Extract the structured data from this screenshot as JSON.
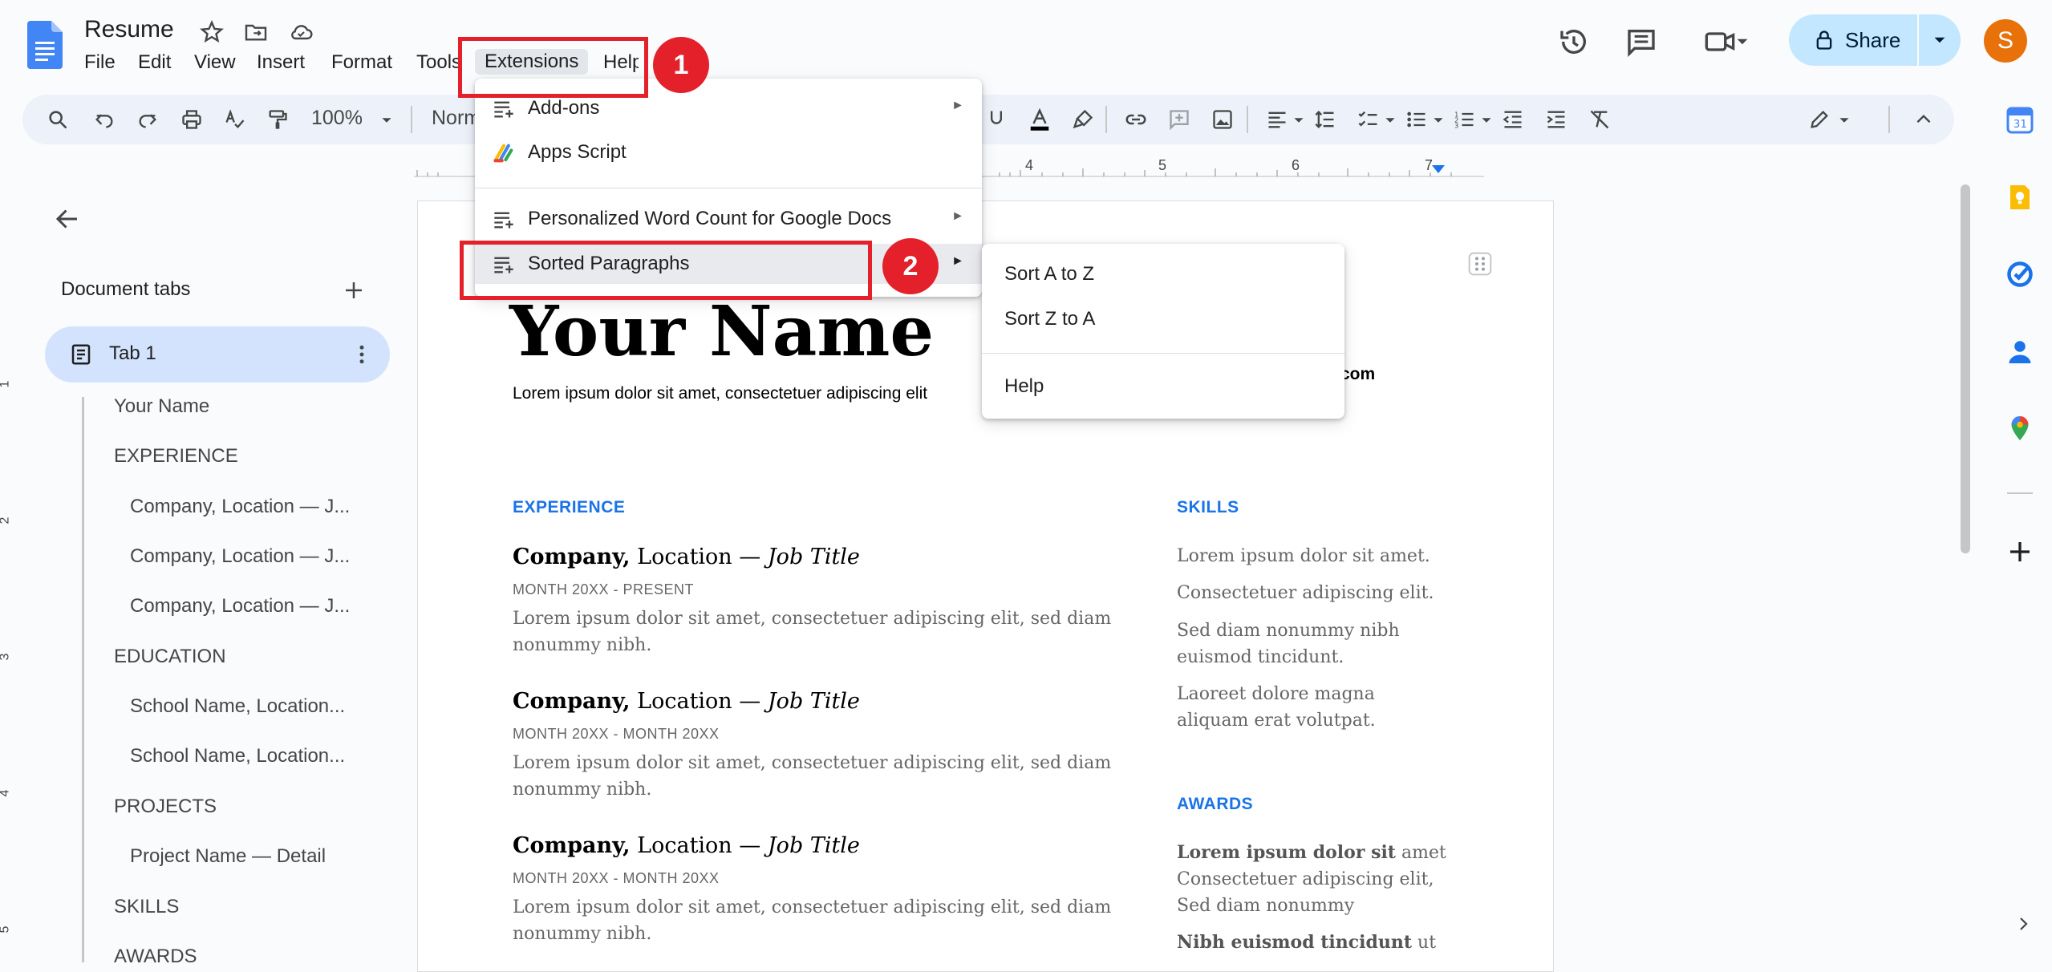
{
  "doc": {
    "title": "Resume"
  },
  "menubar": [
    "File",
    "Edit",
    "View",
    "Insert",
    "Format",
    "Tools",
    "Extensions",
    "Help"
  ],
  "toolbar": {
    "zoom": "100%",
    "style": "Norm"
  },
  "share": {
    "label": "Share"
  },
  "user": {
    "initial": "S"
  },
  "sidebar": {
    "heading": "Document tabs",
    "tab": "Tab 1",
    "outline": [
      "Your Name",
      "EXPERIENCE",
      "Company, Location — J...",
      "Company, Location — J...",
      "Company, Location — J...",
      "EDUCATION",
      "School Name, Location...",
      "School Name, Location...",
      "PROJECTS",
      "Project Name — Detail",
      "SKILLS",
      "AWARDS"
    ]
  },
  "ruler": {
    "numbers": [
      "4",
      "5",
      "6",
      "7"
    ],
    "vertical": [
      "1",
      "2",
      "3",
      "4",
      "5"
    ]
  },
  "extensions_menu": {
    "items": [
      "Add-ons",
      "Apps Script",
      "Personalized Word Count for Google Docs",
      "Sorted Paragraphs"
    ]
  },
  "submenu": {
    "items": [
      "Sort A to Z",
      "Sort Z to A",
      "Help"
    ]
  },
  "badges": [
    "1",
    "2"
  ],
  "document": {
    "name": "Your Name",
    "tagline": "Lorem ipsum dolor sit amet, consectetuer adipiscing elit",
    "contact_fragment": "com",
    "experience_heading": "EXPERIENCE",
    "skills_heading": "SKILLS",
    "awards_heading": "AWARDS",
    "jobs": [
      {
        "company": "Company,",
        "location": " Location — ",
        "title": "Job Title",
        "dates": "MONTH 20XX - PRESENT",
        "desc1": "Lorem ipsum dolor sit amet, consectetuer adipiscing elit, sed diam",
        "desc2": "nonummy nibh."
      },
      {
        "company": "Company,",
        "location": " Location — ",
        "title": "Job Title",
        "dates": "MONTH 20XX - MONTH 20XX",
        "desc1": "Lorem ipsum dolor sit amet, consectetuer adipiscing elit, sed diam",
        "desc2": "nonummy nibh."
      },
      {
        "company": "Company,",
        "location": " Location — ",
        "title": "Job Title",
        "dates": "MONTH 20XX - MONTH 20XX",
        "desc1": "Lorem ipsum dolor sit amet, consectetuer adipiscing elit, sed diam",
        "desc2": "nonummy nibh."
      }
    ],
    "skills": [
      "Lorem ipsum dolor sit amet.",
      "Consectetuer adipiscing elit.",
      "Sed diam nonummy nibh",
      "euismod tincidunt.",
      "Laoreet dolore magna",
      "aliquam erat volutpat."
    ],
    "awards": {
      "line1_bold": "Lorem ipsum dolor sit",
      "line1_rest": " amet",
      "line2": "Consectetuer adipiscing elit,",
      "line3": "Sed diam nonummy",
      "line4_bold": "Nibh euismod tincidunt",
      "line4_rest": " ut"
    }
  },
  "colors": {
    "accent": "#1a73e8",
    "highlight": "#e4202a",
    "share_bg": "#c2e7ff",
    "avatar": "#e8710a"
  }
}
